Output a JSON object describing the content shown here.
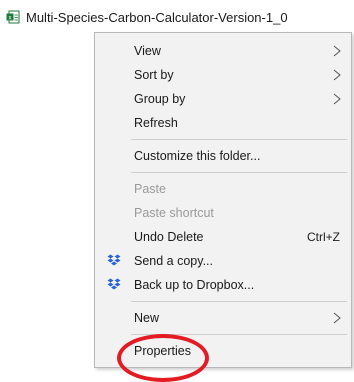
{
  "file": {
    "name": "Multi-Species-Carbon-Calculator-Version-1_0",
    "icon": "excel-file-icon"
  },
  "context_menu": {
    "items": [
      {
        "label": "View",
        "has_submenu": true
      },
      {
        "label": "Sort by",
        "has_submenu": true
      },
      {
        "label": "Group by",
        "has_submenu": true
      },
      {
        "label": "Refresh"
      },
      {
        "label": "Customize this folder..."
      },
      {
        "label": "Paste",
        "disabled": true
      },
      {
        "label": "Paste shortcut",
        "disabled": true
      },
      {
        "label": "Undo Delete",
        "shortcut": "Ctrl+Z"
      },
      {
        "label": "Send a copy...",
        "icon": "dropbox-icon"
      },
      {
        "label": "Back up to Dropbox...",
        "icon": "dropbox-icon"
      },
      {
        "label": "New",
        "has_submenu": true
      },
      {
        "label": "Properties",
        "highlighted_by_annotation": true
      }
    ]
  },
  "colors": {
    "annotation_circle": "#e31b23",
    "dropbox_blue": "#2a64d8",
    "excel_green": "#1f7a3a"
  }
}
